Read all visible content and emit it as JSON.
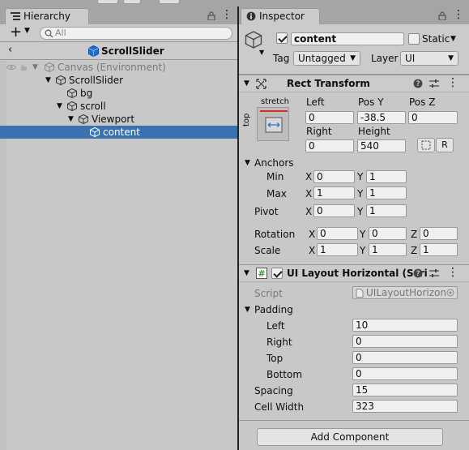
{
  "hierarchy": {
    "tab_label": "Hierarchy",
    "add_label": "+",
    "search_placeholder": "All",
    "scene_title": "ScrollSlider",
    "rows": [
      {
        "label": "Canvas (Environment)",
        "depth": 0
      },
      {
        "label": "ScrollSlider",
        "depth": 1
      },
      {
        "label": "bg",
        "depth": 2
      },
      {
        "label": "scroll",
        "depth": 2
      },
      {
        "label": "Viewport",
        "depth": 3
      },
      {
        "label": "content",
        "depth": 4
      }
    ]
  },
  "inspector": {
    "tab_label": "Inspector",
    "object_name": "content",
    "static_label": "Static",
    "tag_label": "Tag",
    "tag_value": "Untagged",
    "layer_label": "Layer",
    "layer_value": "UI",
    "rect_transform": {
      "title": "Rect Transform",
      "anchor_preset": "stretch",
      "anchor_side": "top",
      "left_label": "Left",
      "left": "0",
      "posy_label": "Pos Y",
      "posy": "-38.5",
      "posz_label": "Pos Z",
      "posz": "0",
      "right_label": "Right",
      "right": "0",
      "height_label": "Height",
      "height": "540",
      "raw_button": "R",
      "anchors_label": "Anchors",
      "min_label": "Min",
      "min_x": "0",
      "min_y": "1",
      "max_label": "Max",
      "max_x": "1",
      "max_y": "1",
      "pivot_label": "Pivot",
      "pivot_x": "0",
      "pivot_y": "1",
      "rotation_label": "Rotation",
      "rot_x": "0",
      "rot_y": "0",
      "rot_z": "0",
      "scale_label": "Scale",
      "scale_x": "1",
      "scale_y": "1",
      "scale_z": "1",
      "x": "X",
      "y": "Y",
      "z": "Z"
    },
    "layout": {
      "title": "UI Layout Horizontal (Scri",
      "script_label": "Script",
      "script_value": "UILayoutHorizon",
      "padding_label": "Padding",
      "left_label": "Left",
      "left": "10",
      "right_label": "Right",
      "right": "0",
      "top_label": "Top",
      "top": "0",
      "bottom_label": "Bottom",
      "bottom": "0",
      "spacing_label": "Spacing",
      "spacing": "15",
      "cell_width_label": "Cell Width",
      "cell_width": "323"
    },
    "add_component": "Add Component"
  },
  "colors": {
    "selection": "#3a72b0",
    "panel": "#c8c8c8",
    "header": "#cbcbcb",
    "cube_blue": "#1a6fd0"
  }
}
